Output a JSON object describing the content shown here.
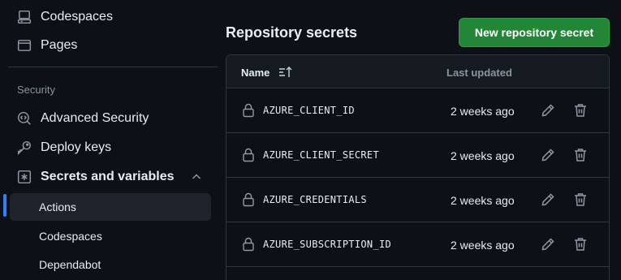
{
  "sidebar": {
    "top_items": [
      {
        "label": "Codespaces",
        "icon": "codespaces-icon"
      },
      {
        "label": "Pages",
        "icon": "pages-icon"
      }
    ],
    "section_label": "Security",
    "security_items": [
      {
        "label": "Advanced Security",
        "icon": "codescan-icon"
      },
      {
        "label": "Deploy keys",
        "icon": "key-icon"
      },
      {
        "label": "Secrets and variables",
        "icon": "asterisk-icon",
        "expanded": true
      }
    ],
    "sub_items": [
      {
        "label": "Actions",
        "active": true
      },
      {
        "label": "Codespaces",
        "active": false
      },
      {
        "label": "Dependabot",
        "active": false
      }
    ]
  },
  "main": {
    "title": "Repository secrets",
    "new_button_label": "New repository secret",
    "table": {
      "header_name": "Name",
      "header_updated": "Last updated",
      "rows": [
        {
          "name": "AZURE_CLIENT_ID",
          "updated": "2 weeks ago"
        },
        {
          "name": "AZURE_CLIENT_SECRET",
          "updated": "2 weeks ago"
        },
        {
          "name": "AZURE_CREDENTIALS",
          "updated": "2 weeks ago"
        },
        {
          "name": "AZURE_SUBSCRIPTION_ID",
          "updated": "2 weeks ago"
        }
      ]
    }
  },
  "colors": {
    "background": "#0d1117",
    "accent_blue": "#2f81f7",
    "button_green": "#238636",
    "border": "#30363d",
    "muted_text": "#8b949e"
  }
}
